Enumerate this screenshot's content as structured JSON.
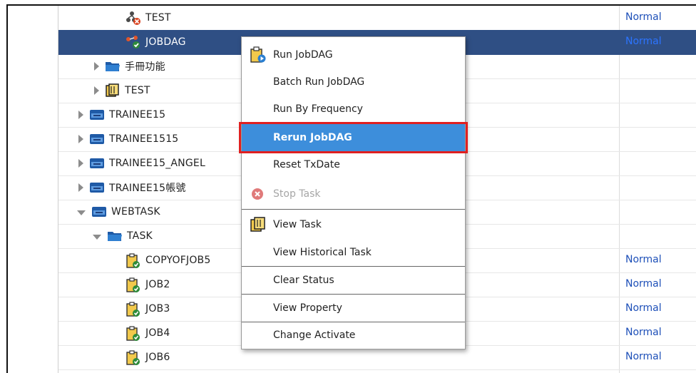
{
  "rows": [
    {
      "label": "TEST",
      "icon": "dag-error-icon",
      "status": "Normal"
    },
    {
      "label": "JOBDAG",
      "icon": "dag-ok-icon",
      "status": "Normal",
      "selected": true
    },
    {
      "label": "手冊功能",
      "icon": "folder-icon",
      "status": ""
    },
    {
      "label": "TEST",
      "icon": "book-icon",
      "status": ""
    },
    {
      "label": "TRAINEE15",
      "icon": "server-icon",
      "status": ""
    },
    {
      "label": "TRAINEE1515",
      "icon": "server-icon",
      "status": ""
    },
    {
      "label": "TRAINEE15_ANGEL",
      "icon": "server-icon",
      "status": ""
    },
    {
      "label": "TRAINEE15帳號",
      "icon": "server-icon",
      "status": ""
    },
    {
      "label": "WEBTASK",
      "icon": "server-icon",
      "status": ""
    },
    {
      "label": "TASK",
      "icon": "folder-icon",
      "status": ""
    },
    {
      "label": "COPYOFJOB5",
      "icon": "job-icon",
      "status": "Normal"
    },
    {
      "label": "JOB2",
      "icon": "job-icon",
      "status": "Normal"
    },
    {
      "label": "JOB3",
      "icon": "job-icon",
      "status": "Normal"
    },
    {
      "label": "JOB4",
      "icon": "job-icon",
      "status": "Normal"
    },
    {
      "label": "JOB6",
      "icon": "job-icon",
      "status": "Normal"
    }
  ],
  "menu": {
    "run_jobdag": "Run JobDAG",
    "batch_run": "Batch Run JobDAG",
    "run_by_frequency": "Run By Frequency",
    "rerun_jobdag": "Rerun JobDAG",
    "reset_txdate": "Reset TxDate",
    "stop_task": "Stop Task",
    "view_task": "View Task",
    "view_historical_task": "View Historical Task",
    "clear_status": "Clear Status",
    "view_property": "View Property",
    "change_activate": "Change Activate"
  },
  "colors": {
    "selected_row": "#2f4f84",
    "menu_highlight": "#3d8edb",
    "highlight_box": "#e02020",
    "status_text": "#1d4fb8"
  }
}
